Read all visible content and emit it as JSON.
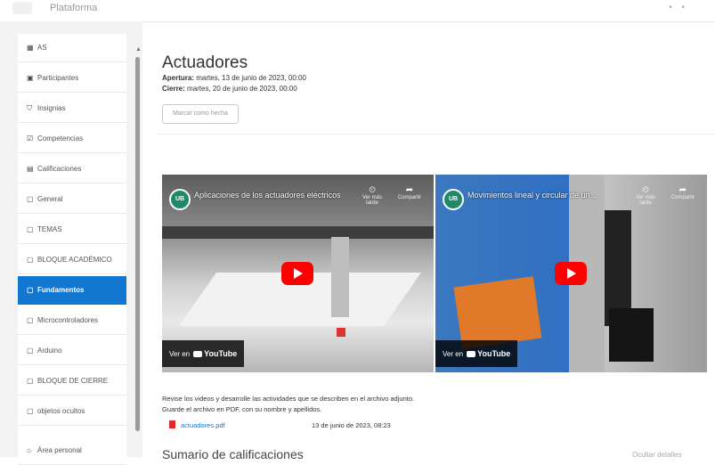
{
  "header": {
    "site_name": "Plataforma",
    "right_icons": "• •"
  },
  "sidebar": {
    "items": [
      {
        "icon": "grid-icon",
        "glyph": "▦",
        "label": "AS"
      },
      {
        "icon": "users-icon",
        "glyph": "👥",
        "label": "Participantes"
      },
      {
        "icon": "badge-icon",
        "glyph": "⛉",
        "label": "Insignias"
      },
      {
        "icon": "checkbox-icon",
        "glyph": "☑",
        "label": "Competencias"
      },
      {
        "icon": "grades-icon",
        "glyph": "▤",
        "label": "Calificaciones"
      },
      {
        "icon": "folder-icon",
        "glyph": "▢",
        "label": "General"
      },
      {
        "icon": "folder-icon",
        "glyph": "▢",
        "label": "TEMAS"
      },
      {
        "icon": "folder-icon",
        "glyph": "▢",
        "label": "BLOQUE ACADÉMICO"
      },
      {
        "icon": "folder-icon",
        "glyph": "▢",
        "label": "Fundamentos",
        "active": true
      },
      {
        "icon": "folder-icon",
        "glyph": "▢",
        "label": "Microcontroladores"
      },
      {
        "icon": "folder-icon",
        "glyph": "▢",
        "label": "Arduino"
      },
      {
        "icon": "folder-icon",
        "glyph": "▢",
        "label": "BLOQUE DE CIERRE"
      },
      {
        "icon": "folder-icon",
        "glyph": "▢",
        "label": "objetos ocultos"
      },
      {
        "icon": "home-icon",
        "glyph": "⌂",
        "label": "Área personal"
      }
    ]
  },
  "main": {
    "title": "Actuadores",
    "opens_label": "Apertura:",
    "opens_value": "martes, 13 de junio de 2023, 00:00",
    "closes_label": "Cierre:",
    "closes_value": "martes, 20 de junio de 2023, 00:00",
    "mark_done_button": "Marcar como hecha",
    "videos": [
      {
        "channel_badge": "UB",
        "title": "Aplicaciones de los actuadores eléctricos",
        "watch_later": "Ver más tarde",
        "share": "Compartir",
        "watch_on": "Ver en",
        "youtube": "YouTube"
      },
      {
        "channel_badge": "UB",
        "title": "Movimientos lineal y circular de un...",
        "watch_later": "Ver más tarde",
        "share": "Compartir",
        "watch_on": "Ver en",
        "youtube": "YouTube"
      }
    ],
    "description_line1": "Revise los videos y desarrolle las actividades que se describen en el archivo adjunto.",
    "description_line2": "Guarde el archivo en PDF, con su nombre y apellidos.",
    "file_name": "actuadores.pdf",
    "file_date": "13 de junio de 2023, 08:23",
    "summary_heading": "Sumario de calificaciones",
    "summary_right": "Ocultar detalles"
  }
}
